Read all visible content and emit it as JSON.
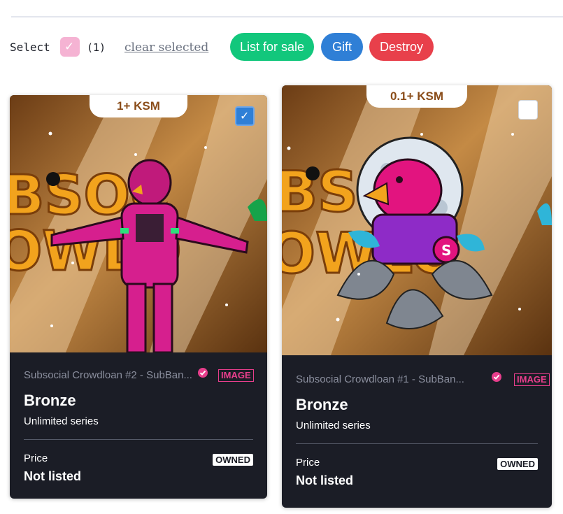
{
  "toolbar": {
    "select_label": "Select",
    "selected_count": "(1)",
    "clear_label": "clear selected",
    "list_for_sale_label": "List for sale",
    "gift_label": "Gift",
    "destroy_label": "Destroy"
  },
  "colors": {
    "list_for_sale": "#12c77c",
    "gift": "#2f7fd6",
    "destroy": "#e8404b",
    "checkbox_selected": "#f5b3d3",
    "card_bg": "#1b1d26",
    "accent_pink": "#e83e8c"
  },
  "cards": [
    {
      "badge": "1+ KSM",
      "selected": true,
      "collection": "Subsocial Crowdloan #2 - SubBan...",
      "media_tag": "IMAGE",
      "name": "Bronze",
      "series": "Unlimited series",
      "price_label": "Price",
      "price_value": "Not listed",
      "status": "OWNED",
      "artwork_icon": "astronaut-bird-icon"
    },
    {
      "badge": "0.1+ KSM",
      "selected": false,
      "collection": "Subsocial Crowdloan #1 - SubBan...",
      "media_tag": "IMAGE",
      "name": "Bronze",
      "series": "Unlimited series",
      "price_label": "Price",
      "price_value": "Not listed",
      "status": "OWNED",
      "artwork_icon": "moon-bird-icon"
    }
  ]
}
